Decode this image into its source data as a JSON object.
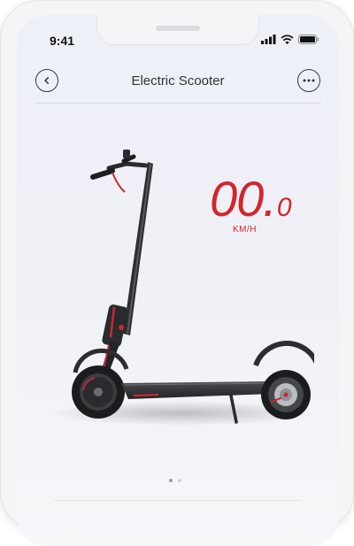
{
  "status_bar": {
    "time": "9:41",
    "icons": [
      "signal-icon",
      "wifi-icon",
      "battery-icon"
    ]
  },
  "header": {
    "title": "Electric Scooter",
    "back_icon": "chevron-left-icon",
    "more_icon": "more-icon"
  },
  "speed": {
    "value_main": "00.",
    "value_decimal": "0",
    "unit": "KM/H"
  },
  "pager": {
    "total": 2,
    "active": 1
  },
  "colors": {
    "accent": "#d3252c",
    "text": "#333333",
    "dot_active": "#9a9ca3",
    "dot_inactive": "#cfd1d6"
  }
}
